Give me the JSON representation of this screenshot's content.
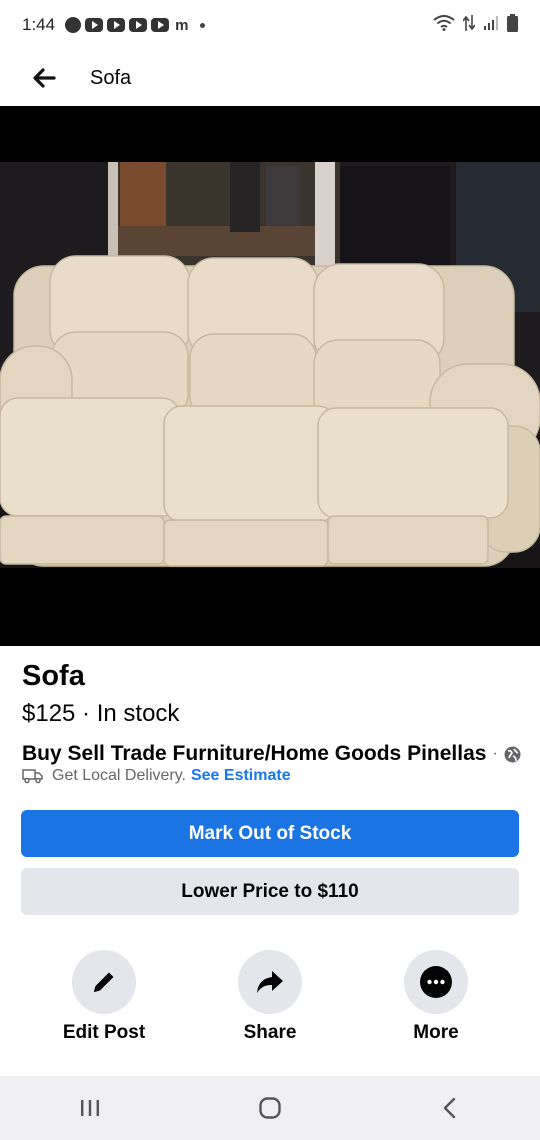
{
  "status_bar": {
    "time": "1:44",
    "notification_icons": [
      "facebook-icon",
      "youtube-icon",
      "youtube-icon",
      "youtube-icon",
      "youtube-icon",
      "mcdonalds-icon"
    ],
    "system_icons": [
      "wifi-icon",
      "data-arrows-icon",
      "signal-icon",
      "battery-icon"
    ]
  },
  "header": {
    "title": "Sofa"
  },
  "listing": {
    "photo_icon": "sofa-photo",
    "title": "Sofa",
    "price_status": "$125 · In stock",
    "group_name": "Buy Sell Trade Furniture/Home Goods Pinellas",
    "group_meta": "·",
    "delivery_text": "Get Local Delivery.",
    "delivery_link": "See Estimate"
  },
  "buttons": {
    "mark_out_of_stock": "Mark Out of Stock",
    "lower_price": "Lower Price to $110"
  },
  "actions": [
    {
      "label": "Edit Post",
      "icon": "pencil-icon"
    },
    {
      "label": "Share",
      "icon": "share-arrow-icon"
    },
    {
      "label": "More",
      "icon": "more-dots-icon"
    }
  ],
  "nav": {
    "icons": [
      "recent-apps-icon",
      "home-icon",
      "back-chevron-icon"
    ]
  },
  "colors": {
    "primary_blue": "#1b74e4",
    "link_blue": "#1877f2",
    "secondary_gray": "#e4e6eb",
    "muted_text": "#65676b",
    "photo_letterbox": "#000000"
  }
}
